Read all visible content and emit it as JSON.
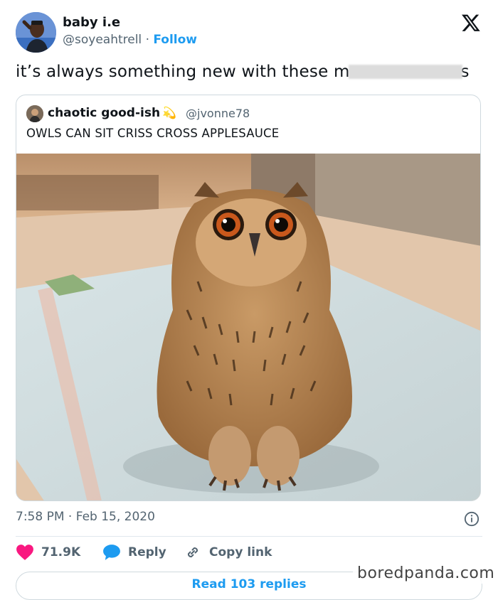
{
  "author": {
    "name": "baby i.e",
    "handle": "@soyeahtrell",
    "separator": "·",
    "follow_label": "Follow"
  },
  "tweet": {
    "text_before": "it’s always something new with these m",
    "text_after": "s"
  },
  "quoted": {
    "name": "chaotic good-ish",
    "emoji": "💫",
    "handle": "@jvonne78",
    "text": "OWLS CAN SIT CRISS CROSS APPLESAUCE"
  },
  "meta": {
    "time": "7:58 PM",
    "separator": "·",
    "date": "Feb 15, 2020"
  },
  "actions": {
    "likes": "71.9K",
    "reply_label": "Reply",
    "copy_label": "Copy link"
  },
  "read_replies_label": "Read 103 replies",
  "watermark": "boredpanda.com",
  "colors": {
    "accent": "#1d9bf0",
    "like": "#f91880",
    "muted": "#536471"
  },
  "icons": {
    "platform": "x-logo-icon",
    "info": "info-icon",
    "like": "heart-icon",
    "reply": "speech-bubble-icon",
    "copy": "link-icon"
  }
}
